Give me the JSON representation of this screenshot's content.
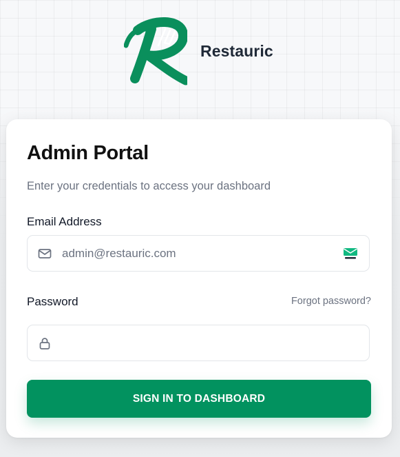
{
  "brand": {
    "name": "Restauric",
    "logo_icon": "restauric-r-fork-logo",
    "logo_color": "#0a8f5c"
  },
  "login": {
    "title": "Admin Portal",
    "subtitle": "Enter your credentials to access your dashboard",
    "email": {
      "label": "Email Address",
      "placeholder": "admin@restauric.com",
      "value": "",
      "icon": "mail-icon",
      "extension_badge": "tempmail-icon"
    },
    "password": {
      "label": "Password",
      "value": "",
      "icon": "lock-icon",
      "forgot_link": "Forgot password?"
    },
    "submit_label": "SIGN IN TO DASHBOARD"
  },
  "colors": {
    "accent": "#02925f",
    "background": "#f7f8fa",
    "card": "#ffffff",
    "text": "#111111",
    "muted": "#6b7280"
  }
}
